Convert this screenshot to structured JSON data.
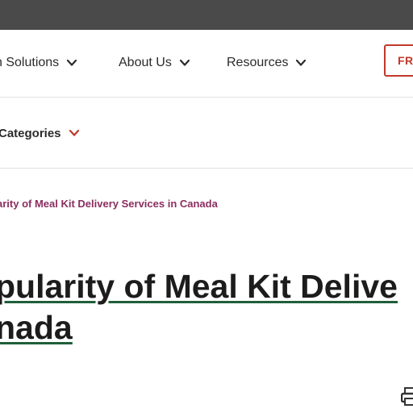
{
  "nav": {
    "items": [
      {
        "label": "h Solutions",
        "icon": "chevron-down-icon"
      },
      {
        "label": "About Us",
        "icon": "chevron-down-icon"
      },
      {
        "label": "Resources",
        "icon": "chevron-down-icon"
      }
    ],
    "cta_label": "FR"
  },
  "subnav": {
    "categories_label": "Categories",
    "icon": "chevron-down-icon",
    "accent_color": "#c0392b"
  },
  "breadcrumb": {
    "current": "arity of Meal Kit Delivery Services in Canada"
  },
  "article": {
    "title_line_1": "pularity of Meal Kit Delive",
    "title_line_2": "nada"
  },
  "toolbar": {
    "print_icon": "print-icon"
  },
  "colors": {
    "browser_bar": "#4a4a4a",
    "breadcrumb": "#8b2d5f",
    "title_underline": "#1f5f3a",
    "cta": "#c0392b"
  }
}
